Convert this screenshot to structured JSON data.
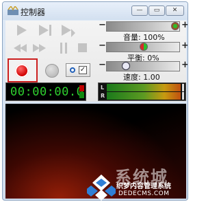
{
  "window": {
    "title": "控制器",
    "buttons": {
      "minimize": "—",
      "maximize": "▭",
      "close": "✕"
    }
  },
  "sliders": {
    "volume": {
      "label": "音量: 100%",
      "value_percent": 100
    },
    "balance": {
      "label": "平衡: 0%",
      "value_percent": 0
    },
    "speed": {
      "label": "速度: 1.00",
      "value": 1.0
    }
  },
  "slider_symbols": {
    "minus": "−",
    "plus": "+"
  },
  "counter": {
    "time": "00:00:00.0"
  },
  "meter": {
    "left_label": "L",
    "right_label": "R"
  },
  "mode": {
    "check_mark": "✓"
  },
  "watermark": {
    "big_text": "系统城",
    "line1": "织梦内容管理系统",
    "line2": "DEDECMS.COM"
  },
  "colors": {
    "record": "#d10000",
    "time_text": "#2fd12f",
    "led_red": "#c00000",
    "led_green": "#118a11"
  },
  "icons": [
    "app-icon",
    "play-icon",
    "next-track-icon",
    "step-forward-icon",
    "rewind-icon",
    "fast-forward-icon",
    "pause-icon",
    "stop-icon",
    "record-icon",
    "pause-record-icon",
    "radio-icon",
    "checkbox-icon"
  ]
}
